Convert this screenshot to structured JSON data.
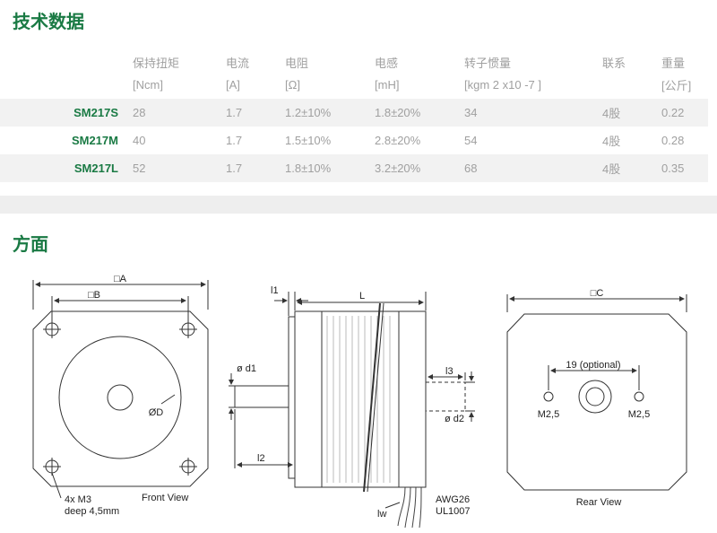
{
  "sections": {
    "tech_title": "技术数据",
    "dims_title": "方面"
  },
  "table": {
    "headers": [
      "保持扭矩",
      "电流",
      "电阻",
      "电感",
      "转子惯量",
      "联系",
      "重量"
    ],
    "units": [
      "[Ncm]",
      "[A]",
      "[Ω]",
      "[mH]",
      "[kgm 2 x10 -7 ]",
      "",
      "[公斤]"
    ],
    "rows": [
      {
        "model": "SM217S",
        "cells": [
          "28",
          "1.7",
          "1.2±10%",
          "1.8±20%",
          "34",
          "4股",
          "0.22"
        ]
      },
      {
        "model": "SM217M",
        "cells": [
          "40",
          "1.7",
          "1.5±10%",
          "2.8±20%",
          "54",
          "4股",
          "0.28"
        ]
      },
      {
        "model": "SM217L",
        "cells": [
          "52",
          "1.7",
          "1.8±10%",
          "3.2±20%",
          "68",
          "4股",
          "0.35"
        ]
      }
    ]
  },
  "drawing": {
    "front": {
      "dim_a": "□A",
      "dim_b": "□B",
      "dim_d": "ØD",
      "hole_note_1": "4x M3",
      "hole_note_2": "deep 4,5mm",
      "caption": "Front View"
    },
    "side": {
      "dim_l1": "l1",
      "dim_l": "L",
      "dim_d1": "ø d1",
      "dim_l2": "l2",
      "dim_l3": "l3",
      "dim_d2": "ø d2",
      "dim_lw": "lw",
      "wire_1": "AWG26",
      "wire_2": "UL1007"
    },
    "rear": {
      "dim_c": "□C",
      "optional": "19 (optional)",
      "m_left": "M2,5",
      "m_right": "M2,5",
      "caption": "Rear View"
    }
  }
}
